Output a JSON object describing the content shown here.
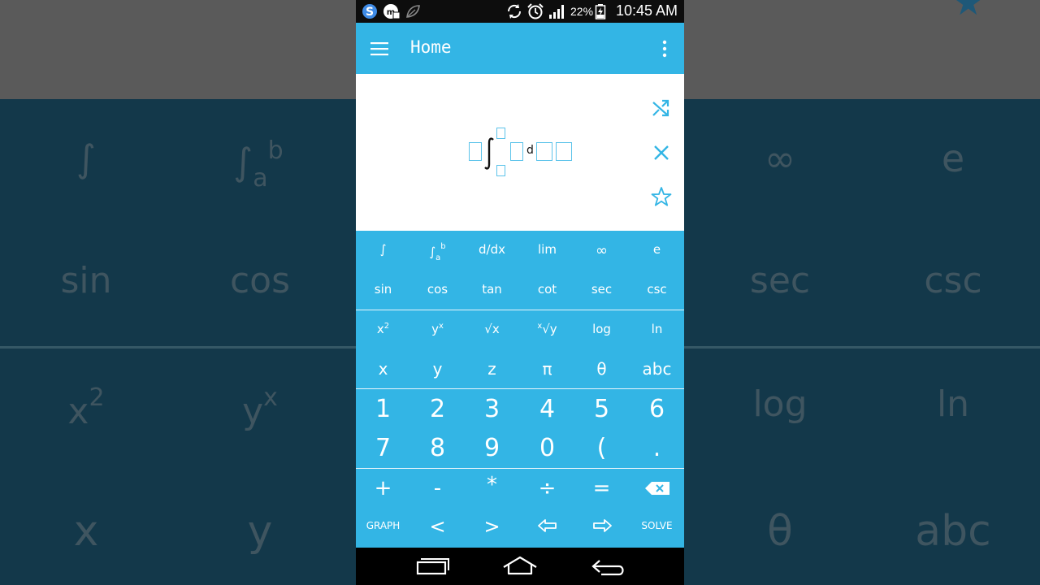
{
  "status_bar": {
    "battery_percent": "22%",
    "time": "10:45 AM"
  },
  "app_bar": {
    "title": "Home"
  },
  "editor": {
    "expression_d": "d"
  },
  "keypad": {
    "row1": [
      "∫",
      "d/dx",
      "lim",
      "∞",
      "e"
    ],
    "definite_integral_sub": "a",
    "definite_integral_sup": "b",
    "row2": [
      "sin",
      "cos",
      "tan",
      "cot",
      "sec",
      "csc"
    ],
    "row3": {
      "x_squared_base": "x",
      "x_squared_exp": "2",
      "y_pow_base": "y",
      "y_pow_exp": "x",
      "sqrt": "√x",
      "nroot_index": "x",
      "nroot_body": "√y",
      "log": "log",
      "ln": "ln"
    },
    "row4": [
      "x",
      "y",
      "z",
      "π",
      "θ",
      "abc"
    ],
    "row5": [
      "1",
      "2",
      "3",
      "4",
      "5",
      "6"
    ],
    "row6": [
      "7",
      "8",
      "9",
      "0",
      "(",
      "."
    ],
    "row7": [
      "+",
      "-",
      "*",
      "÷",
      "="
    ],
    "graph": "GRAPH",
    "less": "<",
    "greater": ">",
    "solve": "SOLVE"
  },
  "background": {
    "row1": [
      "∫",
      "∞",
      "e"
    ],
    "int_sub": "a",
    "int_sup": "b",
    "row2": [
      "sin",
      "cos",
      "sec",
      "csc"
    ],
    "x2_base": "x",
    "x2_exp": "2",
    "yx_base": "y",
    "yx_exp": "x",
    "row3": [
      "log",
      "ln"
    ],
    "row4": [
      "x",
      "y",
      "θ",
      "abc"
    ]
  },
  "colors": {
    "accent": "#33b5e5",
    "status_bar": "#0d0d0d",
    "placeholder": "#5cc3ea",
    "background_blue": "#13384a"
  }
}
